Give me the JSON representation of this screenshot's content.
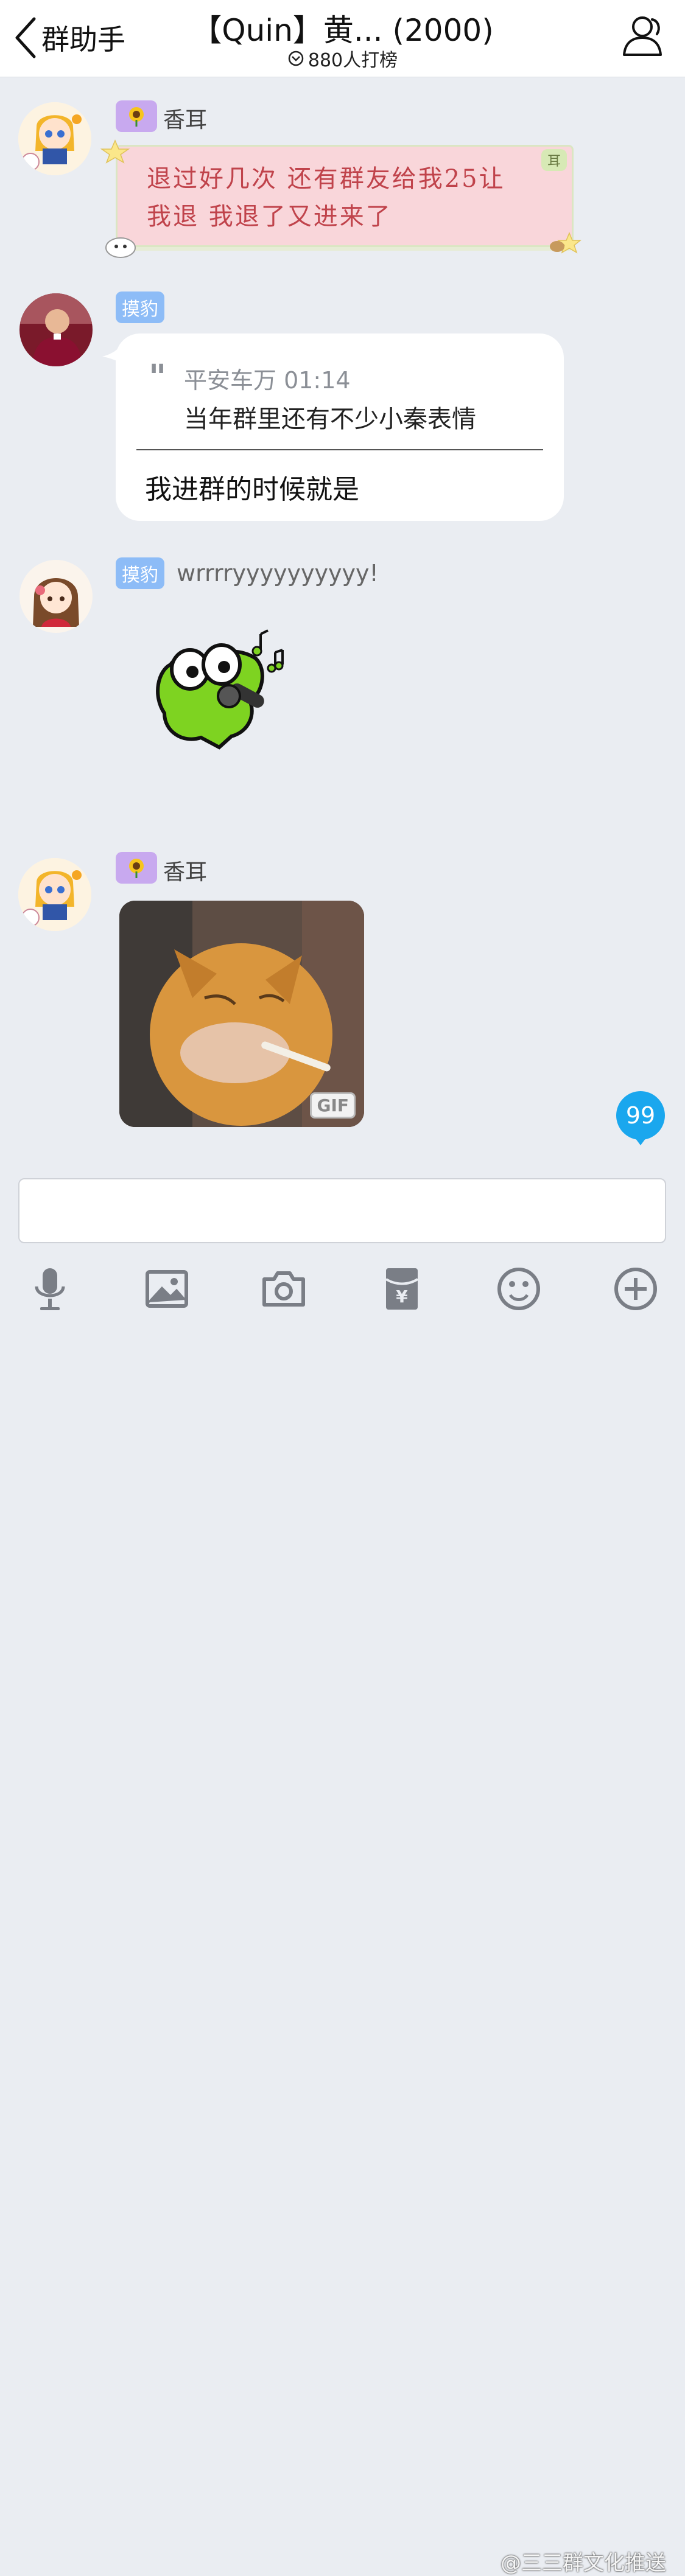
{
  "header": {
    "back_label": "群助手",
    "title": "【Quin】黄... (2000)",
    "subtitle": "880人打榜"
  },
  "messages": [
    {
      "type": "sticker-text",
      "sender": "香耳",
      "badge_icon": "sunflower",
      "text_lines": [
        "退过好几次 还有群友给我25让",
        "我退 我退了又进来了"
      ],
      "bubble_tag": "耳"
    },
    {
      "type": "reply",
      "sender_badge": "摸豹",
      "quote_author_time": "平安车万 01:14",
      "quote_text": "当年群里还有不少小秦表情",
      "reply_text": "我进群的时候就是"
    },
    {
      "type": "text-and-sticker",
      "sender_badge": "摸豹",
      "text": "wrrrryyyyyyyyyy!",
      "sticker": "frog-singing"
    },
    {
      "type": "gif",
      "sender": "香耳",
      "badge_icon": "sunflower",
      "gif_label": "GIF"
    }
  ],
  "unread_count": "99",
  "toolbar": {
    "icons": [
      "microphone-icon",
      "image-icon",
      "camera-icon",
      "red-packet-icon",
      "emoji-icon",
      "plus-icon"
    ]
  },
  "watermark": "@三三群文化推送",
  "colors": {
    "badge_blue": "#8dbcf7",
    "badge_purple": "#c8a9ef",
    "unread_blue": "#1aa7ee",
    "pink_bubble": "#f9d6da",
    "pink_text": "#c0434b"
  }
}
